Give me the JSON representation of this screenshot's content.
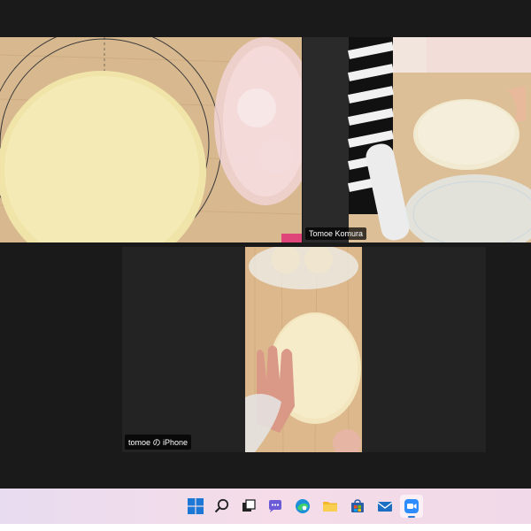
{
  "participants": [
    {
      "id": "tile-1",
      "name": ""
    },
    {
      "id": "tile-2",
      "name": "Tomoe Komura",
      "active_speaker": true
    },
    {
      "id": "tile-3",
      "name": "tomoe の iPhone"
    }
  ],
  "taskbar": {
    "icons": [
      "windows-start-icon",
      "search-icon",
      "task-view-icon",
      "chat-icon",
      "edge-browser-icon",
      "file-explorer-icon",
      "microsoft-store-icon",
      "mail-icon",
      "zoom-app-icon"
    ],
    "active": "zoom-app-icon"
  },
  "colors": {
    "active_speaker_border": "#d7e34a",
    "background": "#1a1a1a",
    "taskbar": "#f0dcea"
  }
}
